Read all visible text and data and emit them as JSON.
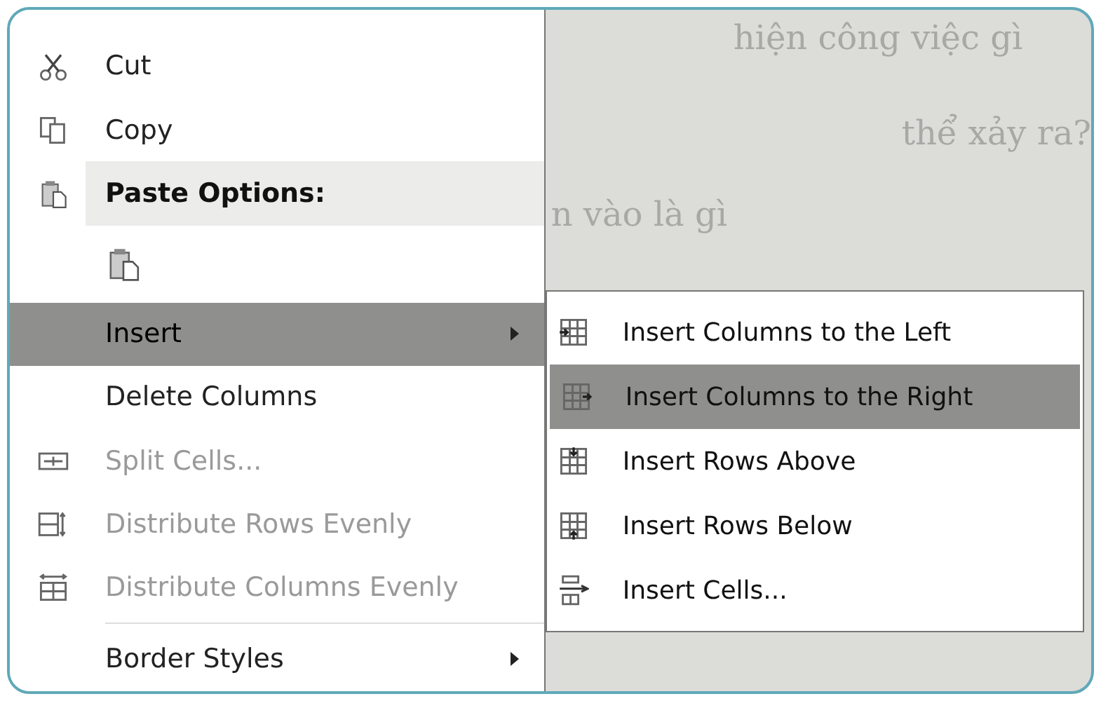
{
  "document": {
    "lines": [
      "hiện công việc gì",
      "thể xảy ra?",
      "n vào là gì"
    ]
  },
  "context_menu": {
    "items": [
      {
        "kind": "command",
        "label": "Cut",
        "disabled": false,
        "selected": false,
        "submenu": false
      },
      {
        "kind": "command",
        "label": "Copy",
        "disabled": false,
        "selected": false,
        "submenu": false
      },
      {
        "kind": "header",
        "label": "Paste Options:"
      },
      {
        "kind": "paste_option"
      },
      {
        "kind": "command",
        "label": "Insert",
        "disabled": false,
        "selected": true,
        "submenu": true
      },
      {
        "kind": "command",
        "label": "Delete Columns",
        "disabled": false,
        "selected": false,
        "submenu": false
      },
      {
        "kind": "command",
        "label": "Split Cells...",
        "disabled": true,
        "selected": false,
        "submenu": false
      },
      {
        "kind": "command",
        "label": "Distribute Rows Evenly",
        "disabled": true,
        "selected": false,
        "submenu": false
      },
      {
        "kind": "command",
        "label": "Distribute Columns Evenly",
        "disabled": true,
        "selected": false,
        "submenu": false
      },
      {
        "kind": "separator"
      },
      {
        "kind": "command",
        "label": "Border Styles",
        "disabled": false,
        "selected": false,
        "submenu": true
      }
    ]
  },
  "submenu": {
    "items": [
      {
        "label": "Insert Columns to the Left",
        "selected": false
      },
      {
        "label": "Insert Columns to the Right",
        "selected": true
      },
      {
        "label": "Insert Rows Above",
        "selected": false
      },
      {
        "label": "Insert Rows Below",
        "selected": false
      },
      {
        "label": "Insert Cells...",
        "selected": false
      }
    ]
  }
}
